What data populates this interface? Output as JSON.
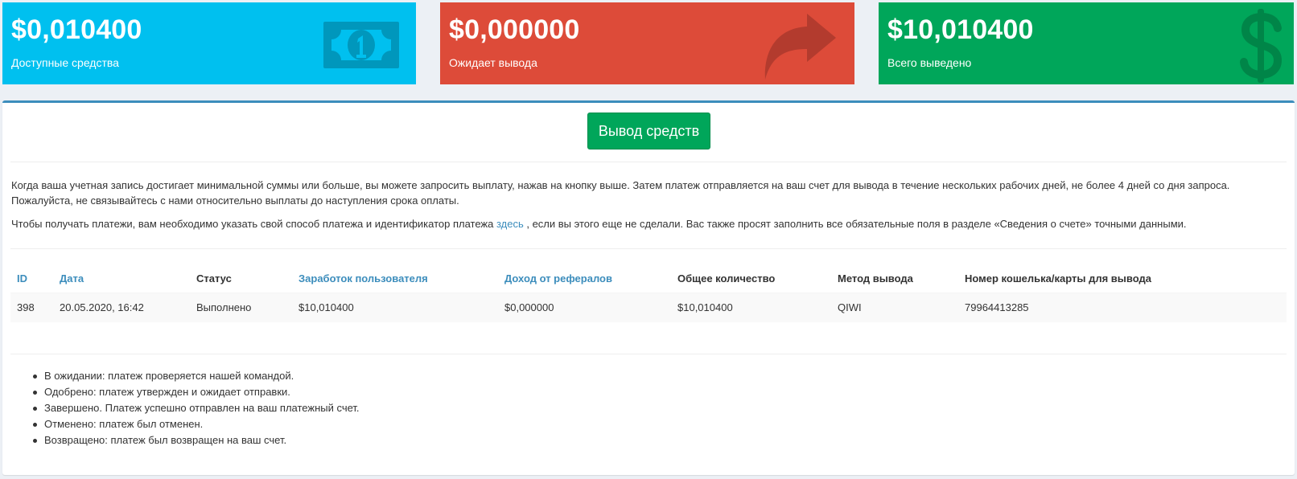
{
  "stats": [
    {
      "amount": "$0,010400",
      "label": "Доступные средства",
      "icon": "money-bill-icon",
      "icon_color": "#0097bc"
    },
    {
      "amount": "$0,000000",
      "label": "Ожидает вывода",
      "icon": "share-arrow-icon",
      "icon_color": "#b33b2e"
    },
    {
      "amount": "$10,010400",
      "label": "Всего выведено",
      "icon": "dollar-icon",
      "icon_color": "#008548"
    }
  ],
  "colors": {
    "aqua": "#00c0ef",
    "red": "#dd4b39",
    "green": "#00a65a",
    "primary": "#3c8dbc"
  },
  "withdraw_button": "Вывод средств",
  "info": {
    "line1": "Когда ваша учетная запись достигает минимальной суммы или больше, вы можете запросить выплату, нажав на кнопку выше. Затем платеж отправляется на ваш счет для вывода в течение нескольких рабочих дней, не более 4 дней со дня запроса.",
    "line2": "Пожалуйста, не связывайтесь с нами относительно выплаты до наступления срока оплаты.",
    "line3_before": "Чтобы получать платежи, вам необходимо указать свой способ платежа и идентификатор платежа ",
    "line3_link": "здесь",
    "line3_after": " , если вы этого еще не сделали. Вас также просят заполнить все обязательные поля в разделе «Сведения о счете» точными данными."
  },
  "table": {
    "headers": [
      "ID",
      "Дата",
      "Статус",
      "Заработок пользователя",
      "Доход от рефералов",
      "Общее количество",
      "Метод вывода",
      "Номер кошелька/карты для вывода"
    ],
    "rows": [
      [
        "398",
        "20.05.2020, 16:42",
        "Выполнено",
        "$10,010400",
        "$0,000000",
        "$10,010400",
        "QIWI",
        "79964413285"
      ]
    ]
  },
  "legend": [
    "В ожидании: платеж проверяется нашей командой.",
    "Одобрено: платеж утвержден и ожидает отправки.",
    "Завершено. Платеж успешно отправлен на ваш платежный счет.",
    "Отменено: платеж был отменен.",
    "Возвращено: платеж был возвращен на ваш счет."
  ]
}
